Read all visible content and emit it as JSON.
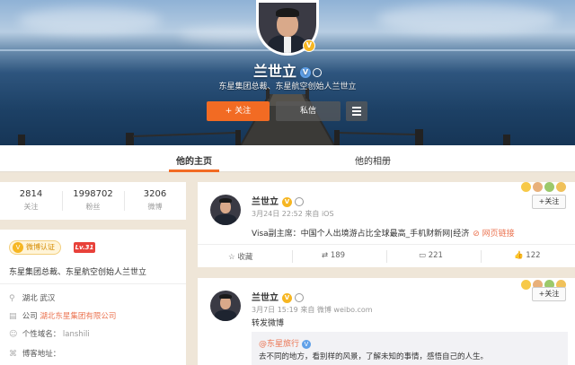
{
  "profile": {
    "name": "兰世立",
    "subtitle": "东星集团总裁、东星航空创始人兰世立",
    "follow_label": "+ 关注",
    "message_label": "私信"
  },
  "tabs": [
    {
      "label": "他的主页",
      "active": true
    },
    {
      "label": "他的相册",
      "active": false
    }
  ],
  "stats": [
    {
      "value": "2814",
      "label": "关注"
    },
    {
      "value": "1998702",
      "label": "粉丝"
    },
    {
      "value": "3206",
      "label": "微博"
    }
  ],
  "info": {
    "verify_badge": "微博认证",
    "level_badge": "Lv.31",
    "description": "东星集团总裁、东星航空创始人兰世立",
    "location": "湖北 武汉",
    "company_label": "公司",
    "company": "湖北东星集团有限公司",
    "domain_label": "个性域名：",
    "domain": "lanshili",
    "blog_label": "博客地址："
  },
  "posts": [
    {
      "author": "兰世立",
      "meta": "3月24日 22:52 来自 iOS",
      "text": "Visa副主席：中国个人出境游占比全球最高_手机财新网|经济",
      "link": "网页链接",
      "follow": "+关注",
      "actions": {
        "favorite": "收藏",
        "repost": "189",
        "comment": "221",
        "like": "122"
      }
    },
    {
      "author": "兰世立",
      "meta": "3月7日 15:19 来自 微博 weibo.com",
      "text": "转发微博",
      "follow": "+关注",
      "repost_author": "@东星旅行",
      "repost_text": "去不同的地方，看别样的风景，了解未知的事情，感悟自己的人生。"
    }
  ],
  "colors": {
    "accent": "#f26b23",
    "link": "#eb7350",
    "verify": "#f6b622"
  }
}
